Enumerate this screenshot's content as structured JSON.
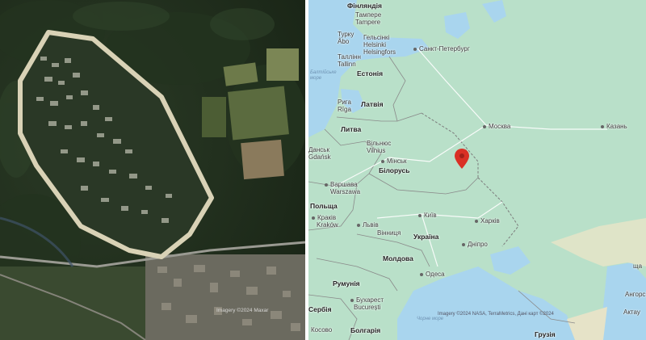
{
  "satellite": {
    "credit": "Imagery ©2024 Maxar"
  },
  "map": {
    "labels": [
      {
        "text": "Фінляндія",
        "bold": true
      },
      {
        "text": "Тампере"
      },
      {
        "text": "Tampere"
      },
      {
        "text": "Турку"
      },
      {
        "text": "Åbo"
      },
      {
        "text": "Гельсінкі"
      },
      {
        "text": "Helsinki"
      },
      {
        "text": "Helsingfors"
      },
      {
        "text": "Санкт-Петербург",
        "city": true
      },
      {
        "text": "Таллінн"
      },
      {
        "text": "Tallinn"
      },
      {
        "text": "Естонія",
        "bold": true
      },
      {
        "text": "Балтійське"
      },
      {
        "text": "море"
      },
      {
        "text": "Рига"
      },
      {
        "text": "Rīga"
      },
      {
        "text": "Латвія",
        "bold": true
      },
      {
        "text": "Москва",
        "city": true
      },
      {
        "text": "Казань",
        "city": true
      },
      {
        "text": "Литва",
        "bold": true
      },
      {
        "text": "Вільнюс"
      },
      {
        "text": "Vilnius"
      },
      {
        "text": "Мінськ",
        "city": true
      },
      {
        "text": "Білорусь",
        "bold": true
      },
      {
        "text": "Данськ"
      },
      {
        "text": "Gdańsk"
      },
      {
        "text": "Варшава",
        "city": true
      },
      {
        "text": "Warszawa"
      },
      {
        "text": "Польща",
        "bold": true
      },
      {
        "text": "Київ",
        "city": true
      },
      {
        "text": "Харків",
        "city": true
      },
      {
        "text": "Краків",
        "city": true
      },
      {
        "text": "Kraków"
      },
      {
        "text": "Львів",
        "city": true
      },
      {
        "text": "Вінниця"
      },
      {
        "text": "Україна",
        "bold": true
      },
      {
        "text": "Дніпро",
        "city": true
      },
      {
        "text": "Молдова",
        "bold": true
      },
      {
        "text": "Одеса",
        "city": true
      },
      {
        "text": "Румунія",
        "bold": true
      },
      {
        "text": "Бухарест",
        "city": true
      },
      {
        "text": "București"
      },
      {
        "text": "Сербія",
        "bold": true
      },
      {
        "text": "Косово"
      },
      {
        "text": "Болгарія",
        "bold": true
      },
      {
        "text": "Чорне море"
      },
      {
        "text": "Грузія",
        "bold": true
      },
      {
        "text": "Актау"
      },
      {
        "text": "Ангорська"
      },
      {
        "text": "ща"
      }
    ],
    "credit": "Imagery ©2024 NASA, TerraMetrics, Дані карт ©2024",
    "marker_icon": "location-pin-icon",
    "marker_color": "#d93025"
  }
}
